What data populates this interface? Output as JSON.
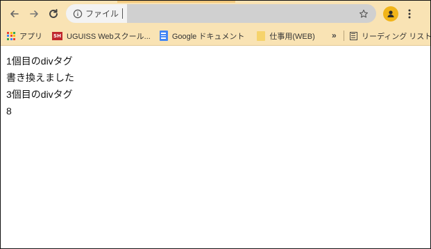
{
  "toolbar": {
    "back_icon": "arrow-left-icon",
    "forward_icon": "arrow-right-icon",
    "reload_icon": "reload-icon",
    "site_info_icon": "info-icon",
    "site_label": "ファイル",
    "bookmark_star_icon": "star-icon",
    "profile_icon": "profile-avatar-icon",
    "menu_icon": "three-dots-vertical-icon",
    "accent_color": "#f9e3b4",
    "profile_color": "#f1b418"
  },
  "bookmarks": {
    "items": [
      {
        "label": "アプリ",
        "icon": "apps-grid-icon"
      },
      {
        "label": "UGUISS Webスクール...",
        "icon": "uguiss-sh-icon",
        "icon_text": "SH"
      },
      {
        "label": "Google ドキュメント",
        "icon": "google-docs-icon"
      },
      {
        "label": "仕事用(WEB)",
        "icon": "folder-icon"
      }
    ],
    "overflow_icon": "double-chevron-right-icon",
    "overflow_symbol": "»",
    "reading_list_label": "リーディング リスト",
    "reading_list_icon": "reading-list-icon"
  },
  "page": {
    "lines": [
      "1個目のdivタグ",
      "書き換えました",
      "3個目のdivタグ",
      "8"
    ]
  }
}
